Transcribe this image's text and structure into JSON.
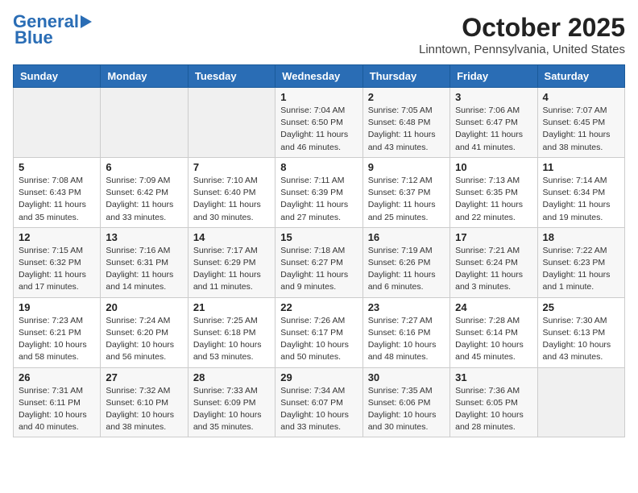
{
  "header": {
    "logo_line1": "General",
    "logo_line2": "Blue",
    "title": "October 2025",
    "subtitle": "Linntown, Pennsylvania, United States"
  },
  "days_of_week": [
    "Sunday",
    "Monday",
    "Tuesday",
    "Wednesday",
    "Thursday",
    "Friday",
    "Saturday"
  ],
  "weeks": [
    [
      {
        "day": "",
        "info": ""
      },
      {
        "day": "",
        "info": ""
      },
      {
        "day": "",
        "info": ""
      },
      {
        "day": "1",
        "info": "Sunrise: 7:04 AM\nSunset: 6:50 PM\nDaylight: 11 hours\nand 46 minutes."
      },
      {
        "day": "2",
        "info": "Sunrise: 7:05 AM\nSunset: 6:48 PM\nDaylight: 11 hours\nand 43 minutes."
      },
      {
        "day": "3",
        "info": "Sunrise: 7:06 AM\nSunset: 6:47 PM\nDaylight: 11 hours\nand 41 minutes."
      },
      {
        "day": "4",
        "info": "Sunrise: 7:07 AM\nSunset: 6:45 PM\nDaylight: 11 hours\nand 38 minutes."
      }
    ],
    [
      {
        "day": "5",
        "info": "Sunrise: 7:08 AM\nSunset: 6:43 PM\nDaylight: 11 hours\nand 35 minutes."
      },
      {
        "day": "6",
        "info": "Sunrise: 7:09 AM\nSunset: 6:42 PM\nDaylight: 11 hours\nand 33 minutes."
      },
      {
        "day": "7",
        "info": "Sunrise: 7:10 AM\nSunset: 6:40 PM\nDaylight: 11 hours\nand 30 minutes."
      },
      {
        "day": "8",
        "info": "Sunrise: 7:11 AM\nSunset: 6:39 PM\nDaylight: 11 hours\nand 27 minutes."
      },
      {
        "day": "9",
        "info": "Sunrise: 7:12 AM\nSunset: 6:37 PM\nDaylight: 11 hours\nand 25 minutes."
      },
      {
        "day": "10",
        "info": "Sunrise: 7:13 AM\nSunset: 6:35 PM\nDaylight: 11 hours\nand 22 minutes."
      },
      {
        "day": "11",
        "info": "Sunrise: 7:14 AM\nSunset: 6:34 PM\nDaylight: 11 hours\nand 19 minutes."
      }
    ],
    [
      {
        "day": "12",
        "info": "Sunrise: 7:15 AM\nSunset: 6:32 PM\nDaylight: 11 hours\nand 17 minutes."
      },
      {
        "day": "13",
        "info": "Sunrise: 7:16 AM\nSunset: 6:31 PM\nDaylight: 11 hours\nand 14 minutes."
      },
      {
        "day": "14",
        "info": "Sunrise: 7:17 AM\nSunset: 6:29 PM\nDaylight: 11 hours\nand 11 minutes."
      },
      {
        "day": "15",
        "info": "Sunrise: 7:18 AM\nSunset: 6:27 PM\nDaylight: 11 hours\nand 9 minutes."
      },
      {
        "day": "16",
        "info": "Sunrise: 7:19 AM\nSunset: 6:26 PM\nDaylight: 11 hours\nand 6 minutes."
      },
      {
        "day": "17",
        "info": "Sunrise: 7:21 AM\nSunset: 6:24 PM\nDaylight: 11 hours\nand 3 minutes."
      },
      {
        "day": "18",
        "info": "Sunrise: 7:22 AM\nSunset: 6:23 PM\nDaylight: 11 hours\nand 1 minute."
      }
    ],
    [
      {
        "day": "19",
        "info": "Sunrise: 7:23 AM\nSunset: 6:21 PM\nDaylight: 10 hours\nand 58 minutes."
      },
      {
        "day": "20",
        "info": "Sunrise: 7:24 AM\nSunset: 6:20 PM\nDaylight: 10 hours\nand 56 minutes."
      },
      {
        "day": "21",
        "info": "Sunrise: 7:25 AM\nSunset: 6:18 PM\nDaylight: 10 hours\nand 53 minutes."
      },
      {
        "day": "22",
        "info": "Sunrise: 7:26 AM\nSunset: 6:17 PM\nDaylight: 10 hours\nand 50 minutes."
      },
      {
        "day": "23",
        "info": "Sunrise: 7:27 AM\nSunset: 6:16 PM\nDaylight: 10 hours\nand 48 minutes."
      },
      {
        "day": "24",
        "info": "Sunrise: 7:28 AM\nSunset: 6:14 PM\nDaylight: 10 hours\nand 45 minutes."
      },
      {
        "day": "25",
        "info": "Sunrise: 7:30 AM\nSunset: 6:13 PM\nDaylight: 10 hours\nand 43 minutes."
      }
    ],
    [
      {
        "day": "26",
        "info": "Sunrise: 7:31 AM\nSunset: 6:11 PM\nDaylight: 10 hours\nand 40 minutes."
      },
      {
        "day": "27",
        "info": "Sunrise: 7:32 AM\nSunset: 6:10 PM\nDaylight: 10 hours\nand 38 minutes."
      },
      {
        "day": "28",
        "info": "Sunrise: 7:33 AM\nSunset: 6:09 PM\nDaylight: 10 hours\nand 35 minutes."
      },
      {
        "day": "29",
        "info": "Sunrise: 7:34 AM\nSunset: 6:07 PM\nDaylight: 10 hours\nand 33 minutes."
      },
      {
        "day": "30",
        "info": "Sunrise: 7:35 AM\nSunset: 6:06 PM\nDaylight: 10 hours\nand 30 minutes."
      },
      {
        "day": "31",
        "info": "Sunrise: 7:36 AM\nSunset: 6:05 PM\nDaylight: 10 hours\nand 28 minutes."
      },
      {
        "day": "",
        "info": ""
      }
    ]
  ]
}
